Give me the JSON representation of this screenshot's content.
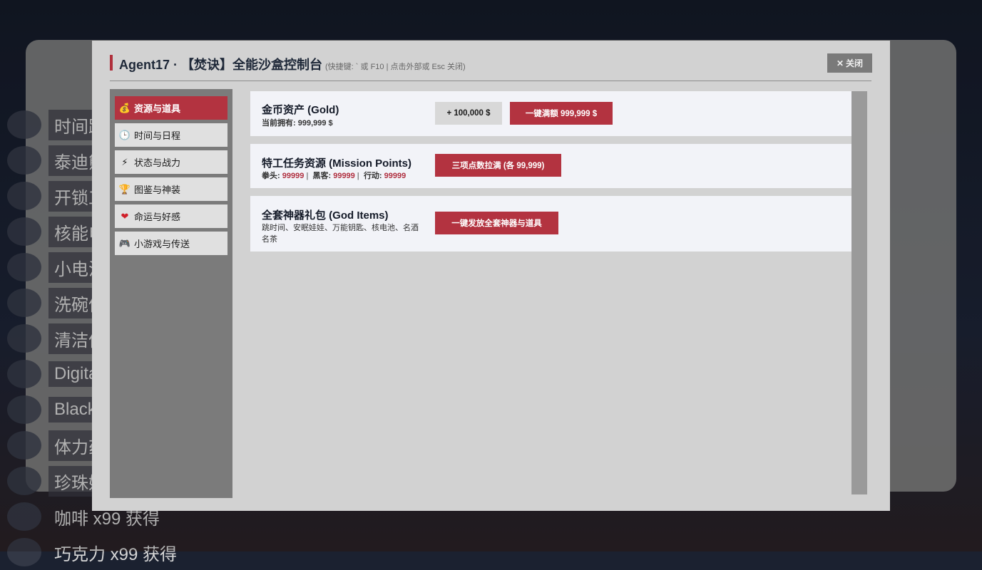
{
  "background": {
    "items": [
      {
        "label": "时间跳"
      },
      {
        "label": "泰迪熊"
      },
      {
        "label": "开锁工"
      },
      {
        "label": "核能电"
      },
      {
        "label": "小电池"
      },
      {
        "label": "洗碗仙"
      },
      {
        "label": "清洁仙"
      },
      {
        "label": "Digita"
      },
      {
        "label": "Black"
      },
      {
        "label": "体力药"
      },
      {
        "label": "珍珠奶"
      },
      {
        "label": "咖啡 x99 获得"
      },
      {
        "label": "巧克力 x99 获得"
      }
    ]
  },
  "header": {
    "title": "Agent17 · 【焚诀】全能沙盒控制台",
    "hint": "(快捷键: ` 或 F10 | 点击外部或 Esc 关闭)",
    "close_icon": "✕",
    "close_label": "关闭"
  },
  "sidebar": {
    "items": [
      {
        "icon": "💰",
        "label": "资源与道具",
        "active": true
      },
      {
        "icon": "🕒",
        "label": "时间与日程"
      },
      {
        "icon": "⚡",
        "label": "状态与战力"
      },
      {
        "icon": "🏆",
        "label": "图鉴与神装"
      },
      {
        "icon": "❤",
        "label": "命运与好感"
      },
      {
        "icon": "🎮",
        "label": "小游戏与传送"
      }
    ]
  },
  "cards": {
    "gold": {
      "title": "金币资产 (Gold)",
      "owned_label": "当前拥有:",
      "owned_value": "999,999 $",
      "add_button": "+ 100,000 $",
      "max_button": "一键满额 999,999 $"
    },
    "mission": {
      "title": "特工任务资源 (Mission Points)",
      "fist_label": "拳头:",
      "fist_value": "99999",
      "hacker_label": "黑客:",
      "hacker_value": "99999",
      "action_label": "行动:",
      "action_value": "99999",
      "max_button": "三项点数拉满 (各 99,999)"
    },
    "god": {
      "title": "全套神器礼包 (God Items)",
      "desc_line1": "跳时间、安眠娃娃、万能钥匙、核电池、名酒",
      "desc_line2": "名茶",
      "issue_button": "一键发放全套神器与道具"
    }
  }
}
